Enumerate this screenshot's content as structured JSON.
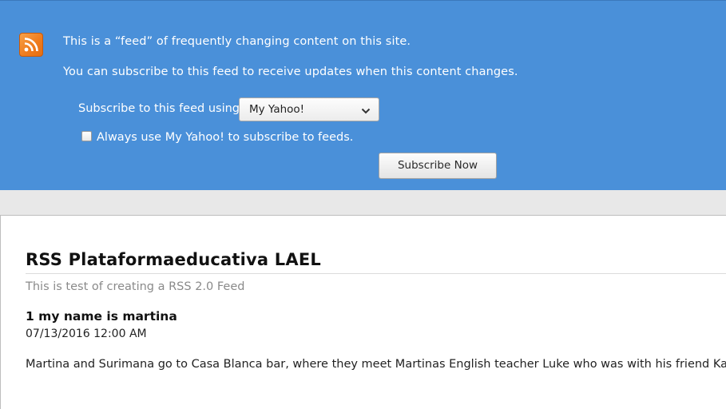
{
  "header": {
    "intro_line1": "This is a “feed” of frequently changing content on this site.",
    "intro_line2": "You can subscribe to this feed to receive updates when this content changes.",
    "subscribe_label": "Subscribe to this feed using",
    "reader_selected": "My Yahoo!",
    "always_use_label": "Always use My Yahoo! to subscribe to feeds.",
    "always_use_checked": false,
    "subscribe_button": "Subscribe Now",
    "accent_color": "#4a90d9",
    "icon": "rss-icon"
  },
  "feed": {
    "title": "RSS Plataformaeducativa LAEL",
    "subtitle": "This is test of creating a RSS 2.0 Feed",
    "items": [
      {
        "title": "1 my name is martina",
        "date": "07/13/2016 12:00 AM",
        "description": "Martina and Surimana go to Casa Blanca bar, where they meet Martinas English teacher Luke who was with his friend Kate."
      }
    ]
  }
}
